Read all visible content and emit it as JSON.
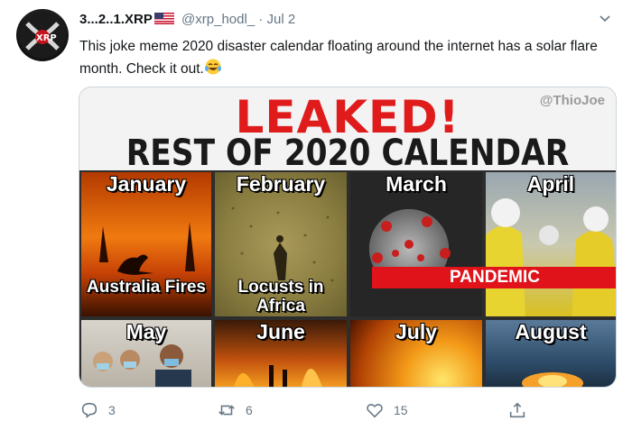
{
  "tweet": {
    "display_name": "3...2..1.XRP",
    "handle": "@xrp_hodl_",
    "separator": "·",
    "date": "Jul 2",
    "text": "This joke meme 2020 disaster calendar floating around the internet has a solar flare month. Check it out.",
    "avatar_label": "XRP"
  },
  "media": {
    "watermark": "@ThioJoe",
    "headline": "LEAKED!",
    "subheadline": "REST OF 2020 CALENDAR",
    "months": [
      {
        "name": "January",
        "caption": "Australia Fires"
      },
      {
        "name": "February",
        "caption": "Locusts in Africa"
      },
      {
        "name": "March",
        "caption": ""
      },
      {
        "name": "April",
        "caption": "PANDEMIC"
      },
      {
        "name": "May",
        "caption": ""
      },
      {
        "name": "June",
        "caption": ""
      },
      {
        "name": "July",
        "caption": ""
      },
      {
        "name": "August",
        "caption": ""
      }
    ]
  },
  "actions": {
    "replies": "3",
    "retweets": "6",
    "likes": "15"
  },
  "icons": {
    "reply": "reply-icon",
    "retweet": "retweet-icon",
    "like": "heart-icon",
    "share": "share-icon",
    "more": "chevron-down-icon",
    "flag": "us-flag-icon",
    "emoji": "tears-of-joy-emoji"
  }
}
